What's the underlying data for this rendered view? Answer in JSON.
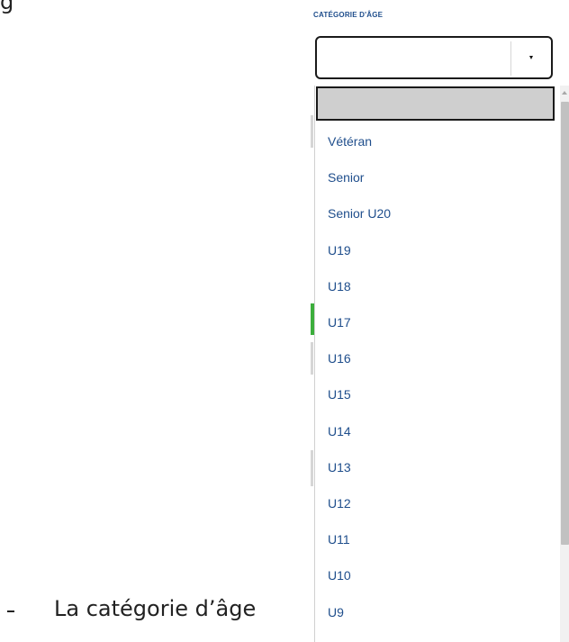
{
  "field": {
    "label": "CATÉGORIE D'ÂGE",
    "selected_value": ""
  },
  "dropdown": {
    "options": [
      "Vétéran",
      "Senior",
      "Senior U20",
      "U19",
      "U18",
      "U17",
      "U16",
      "U15",
      "U14",
      "U13",
      "U12",
      "U11",
      "U10",
      "U9"
    ]
  },
  "document": {
    "bullet_text": "La catégorie d’âge",
    "top_fragment": "g"
  },
  "colors": {
    "label_blue": "#1f4e8c",
    "highlight_gray": "#cfcfcf",
    "marker_green": "#3cae3c"
  },
  "icons": {
    "select_arrow": "chevron-down-icon",
    "scroll_up": "scroll-up-arrow-icon"
  }
}
